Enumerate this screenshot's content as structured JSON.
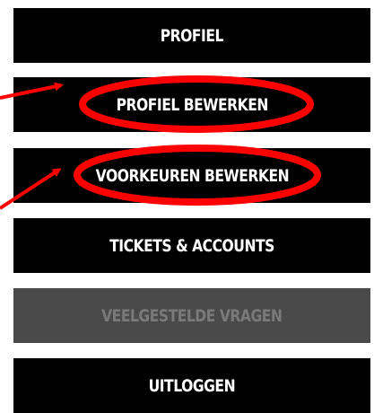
{
  "menu": {
    "items": [
      {
        "label": "PROFIEL",
        "enabled": true
      },
      {
        "label": "PROFIEL BEWERKEN",
        "enabled": true,
        "highlighted": true
      },
      {
        "label": "VOORKEUREN BEWERKEN",
        "enabled": true,
        "highlighted": true
      },
      {
        "label": "TICKETS & ACCOUNTS",
        "enabled": true
      },
      {
        "label": "VEELGESTELDE VRAGEN",
        "enabled": false
      },
      {
        "label": "UITLOGGEN",
        "enabled": true
      }
    ]
  },
  "colors": {
    "button_background": "#000000",
    "button_disabled_background": "#4a4a4a",
    "button_text": "#ffffff",
    "button_disabled_text": "#7a7a7a",
    "annotation": "#ff0000"
  }
}
